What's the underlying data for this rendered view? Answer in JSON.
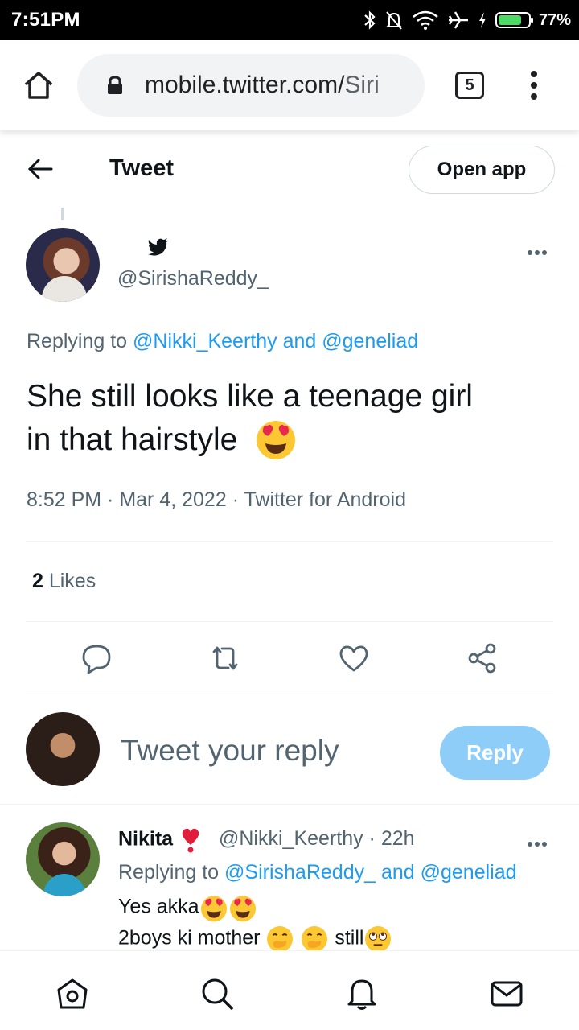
{
  "status_bar": {
    "time": "7:51PM",
    "battery_percent": "77%",
    "battery_level": 0.77,
    "icons": [
      "bluetooth-icon",
      "mute-icon",
      "wifi-icon",
      "airplane-icon",
      "charging-icon",
      "battery-icon"
    ]
  },
  "browser": {
    "url_host": "mobile.twitter.com/",
    "url_path": "Siri",
    "tab_count": "5",
    "accent": "#202124"
  },
  "header": {
    "title": "Tweet",
    "open_app_label": "Open app"
  },
  "tweet": {
    "handle": "@SirishaReddy_",
    "replying_prefix": "Replying to ",
    "replying_user1": "@Nikki_Keerthy",
    "replying_and": " and ",
    "replying_user2": "@geneliad",
    "text_line1": "She still looks like a teenage girl",
    "text_line2": "in that hairstyle",
    "time": "8:52 PM",
    "sep1": " · ",
    "date": "Mar 4, 2022",
    "sep2": " · ",
    "source": "Twitter for Android",
    "likes_count": "2",
    "likes_label": " Likes"
  },
  "compose": {
    "placeholder": "Tweet your reply",
    "reply_label": "Reply"
  },
  "reply": {
    "name": "Nikita",
    "handle_time": "@Nikki_Keerthy · 22h",
    "replying_prefix": "Replying to ",
    "replying_user1": "@SirishaReddy_",
    "replying_and": " and ",
    "replying_user2": "@geneliad",
    "line1": "Yes akka",
    "line2_a": "2boys ki mother ",
    "line2_b": "still"
  },
  "colors": {
    "link": "#1d9bf0",
    "reply_button": "#8ecdf8",
    "secondary_text": "#536471"
  }
}
